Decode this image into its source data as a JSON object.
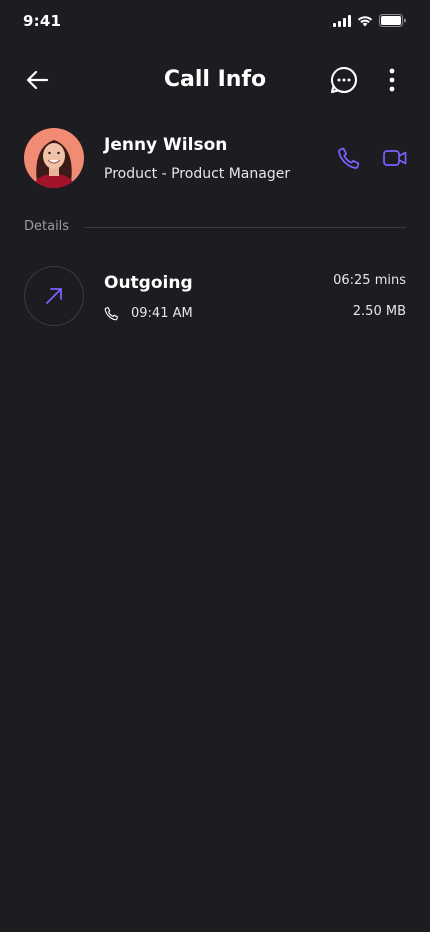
{
  "status_bar": {
    "time": "9:41"
  },
  "header": {
    "title": "Call Info"
  },
  "contact": {
    "name": "Jenny Wilson",
    "role": "Product - Product Manager"
  },
  "details": {
    "label": "Details"
  },
  "call_log": [
    {
      "type": "Outgoing",
      "time": "09:41 AM",
      "duration": "06:25 mins",
      "size": "2.50 MB",
      "direction_icon": "arrow-up-right-icon"
    }
  ],
  "colors": {
    "background": "#1c1c21",
    "accent": "#7b61ff",
    "text": "#ffffff",
    "muted": "#9a9aa3",
    "divider": "#3a3a42",
    "avatar_bg": "#f28b73"
  }
}
